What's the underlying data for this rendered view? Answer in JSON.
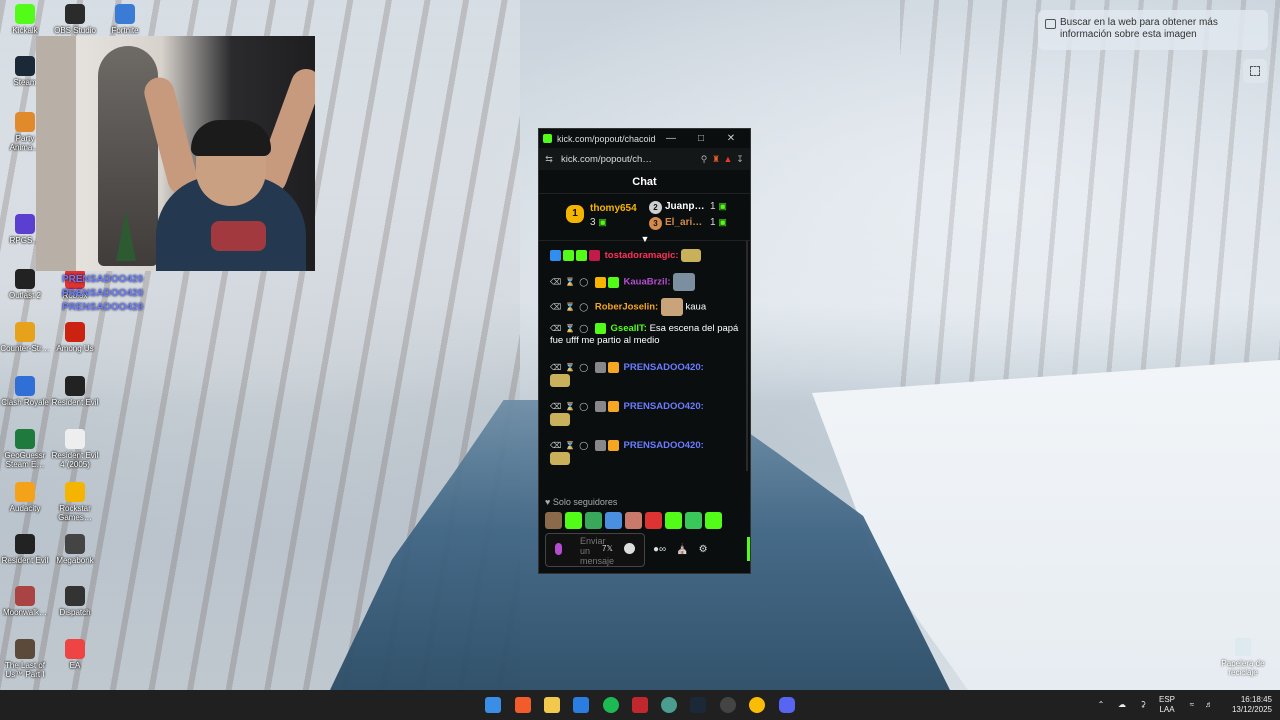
{
  "desktop": {
    "icons": [
      {
        "label": "Kickalk",
        "color": "#53fc18"
      },
      {
        "label": "OBS Studio",
        "color": "#2b2b2b"
      },
      {
        "label": "Fortnite",
        "color": "#3a7bd5"
      },
      {
        "label": "Steam",
        "color": "#1b2838"
      },
      {
        "label": "Party Anima…",
        "color": "#e08a2c"
      },
      {
        "label": "RPGS…",
        "color": "#5a3fd1"
      },
      {
        "label": "Outlast 2",
        "color": "#222"
      },
      {
        "label": "Roblox",
        "color": "#d33"
      },
      {
        "label": "Counter-Str…",
        "color": "#e6a21a"
      },
      {
        "label": "Among Us",
        "color": "#c21"
      },
      {
        "label": "Clash Royale",
        "color": "#2f6fd6"
      },
      {
        "label": "Resident Evil",
        "color": "#222"
      },
      {
        "label": "GeoGuessr Steam E…",
        "color": "#1e7a3d"
      },
      {
        "label": "Resident Evil 4 (2005)",
        "color": "#eee"
      },
      {
        "label": "Audacity",
        "color": "#f3a21a"
      },
      {
        "label": "Rockstar Games…",
        "color": "#f5b400"
      },
      {
        "label": "Resident Evil",
        "color": "#222"
      },
      {
        "label": "Megabonk",
        "color": "#444"
      },
      {
        "label": "Moonwalk…",
        "color": "#a44"
      },
      {
        "label": "Dispatch",
        "color": "#333"
      },
      {
        "label": "The Last of Us™ Part I",
        "color": "#5b4a3a"
      },
      {
        "label": "EA",
        "color": "#e44"
      }
    ],
    "overlay_repeats": [
      "PRENSADOO420",
      "PRENSADOO420",
      "PRENSADOO420"
    ],
    "recycle_bin": "Papelera de reciclaje"
  },
  "lens": {
    "hint_text": "Buscar en la web para obtener más información sobre esta imagen"
  },
  "popup": {
    "window_title": "kick.com/popout/chacoide/…",
    "url": "kick.com/popout/ch…",
    "chat_title": "Chat",
    "leaderboard": [
      {
        "rank": "1",
        "name": "thomy654",
        "count": "3",
        "color": "#f5b400"
      },
      {
        "rank": "2",
        "name": "Juanp…",
        "count": "1",
        "color": "#cfcfcf"
      },
      {
        "rank": "3",
        "name": "El_ari…",
        "count": "1",
        "color": "#d48a4a"
      }
    ],
    "messages": [
      {
        "user": "tostadoramagic:",
        "color": "#f04",
        "text": ""
      },
      {
        "user": "KauaBrzil:",
        "color": "#b44dd0",
        "text": ""
      },
      {
        "user": "RoberJoselin:",
        "color": "#f5a623",
        "text": "kaua"
      },
      {
        "user": "GsealIT:",
        "color": "#53fc18",
        "text": "Esa escena del papá fue ufff me partio al medio"
      },
      {
        "user": "PRENSADOO420:",
        "color": "#6b7cff",
        "text": ""
      },
      {
        "user": "PRENSADOO420:",
        "color": "#6b7cff",
        "text": ""
      },
      {
        "user": "PRENSADOO420:",
        "color": "#6b7cff",
        "text": ""
      }
    ],
    "followers_only": "Solo seguidores",
    "input_placeholder": "Enviar un mensaje"
  },
  "taskbar": {
    "lang": "ESP",
    "region": "LAA",
    "time": "16:18:45",
    "date": "13/12/2025"
  },
  "colors": {
    "kick_green": "#53fc18",
    "taskbar": "#202020"
  }
}
